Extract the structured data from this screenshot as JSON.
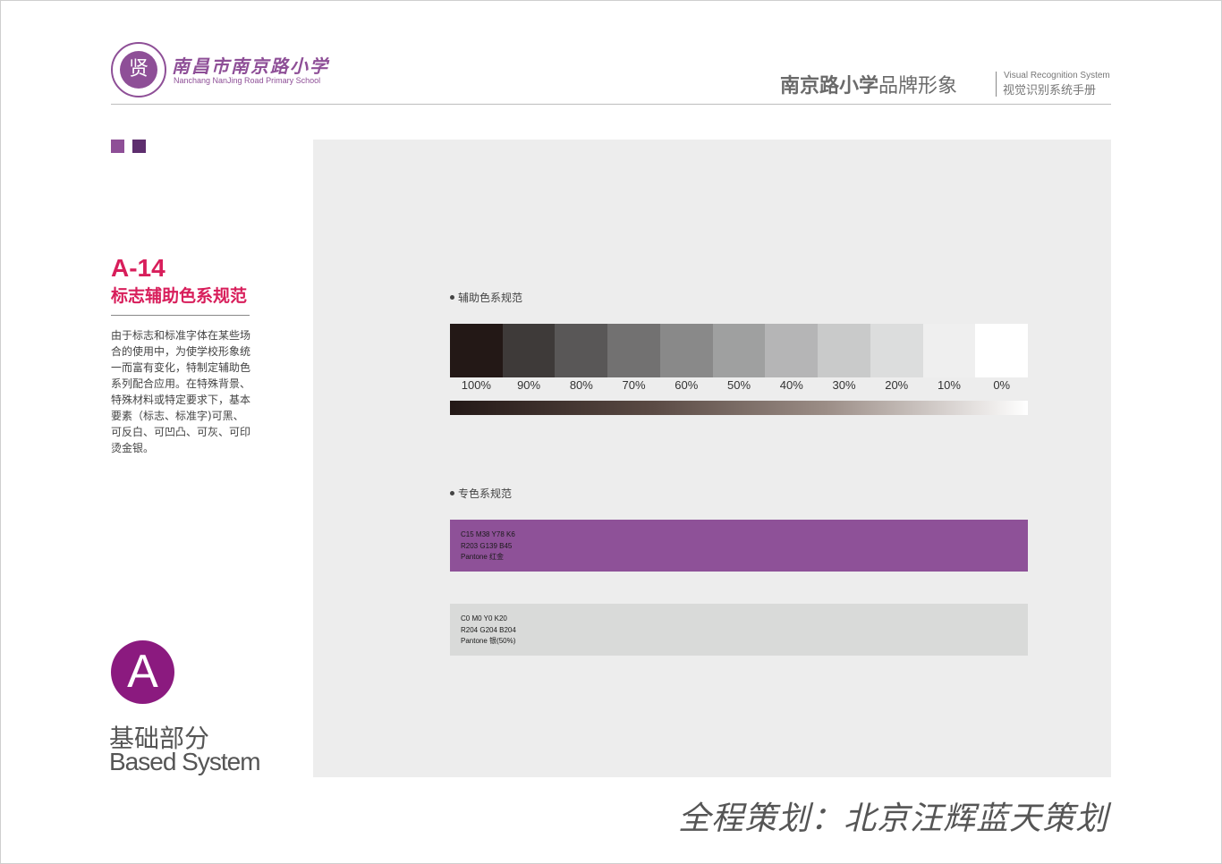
{
  "header": {
    "logo_glyph": "贤",
    "school_name_cn": "南昌市南京路小学",
    "school_name_en": "Nanchang NanJing Road Primary School",
    "brand_title_bold": "南京路小学",
    "brand_title_rest": "品牌形象",
    "brand_en": "Visual Recognition System",
    "brand_cn": "视觉识别系统手册"
  },
  "colors": {
    "accent_red": "#d81e5b",
    "brand_purple": "#8e4f97",
    "part_circle": "#8b1a7f"
  },
  "section": {
    "code": "A-14",
    "title": "标志辅助色系规范",
    "description": "由于标志和标准字体在某些场合的使用中，为使学校形象统一而富有变化，特制定辅助色系列配合应用。在特殊背景、特殊材料或特定要求下，基本要素（标志、标准字)可黑、可反白、可凹凸、可灰、可印烫金银。"
  },
  "part": {
    "letter": "A",
    "name_cn": "基础部分",
    "name_en": "Based System"
  },
  "auxiliary": {
    "label": "辅助色系规范",
    "swatches": [
      {
        "pct": "100%",
        "color": "#231816"
      },
      {
        "pct": "90%",
        "color": "#3e3a39"
      },
      {
        "pct": "80%",
        "color": "#595757"
      },
      {
        "pct": "70%",
        "color": "#727171"
      },
      {
        "pct": "60%",
        "color": "#898989"
      },
      {
        "pct": "50%",
        "color": "#9fa0a0"
      },
      {
        "pct": "40%",
        "color": "#b5b5b6"
      },
      {
        "pct": "30%",
        "color": "#c9caca"
      },
      {
        "pct": "20%",
        "color": "#dcdddd"
      },
      {
        "pct": "10%",
        "color": "#efefef"
      },
      {
        "pct": "0%",
        "color": "#ffffff"
      }
    ]
  },
  "spot": {
    "label": "专色系规范",
    "items": [
      {
        "line1": "C15 M38 Y78  K6",
        "line2": "R203 G139 B45",
        "line3": "Pantone 红金",
        "color": "#8e5198"
      },
      {
        "line1": "C0 M0 Y0 K20",
        "line2": "R204 G204 B204",
        "line3": "Pantone 银(50%)",
        "color": "#d9dad9"
      }
    ]
  },
  "footer": {
    "text": "全程策划：北京汪辉蓝天策划"
  }
}
